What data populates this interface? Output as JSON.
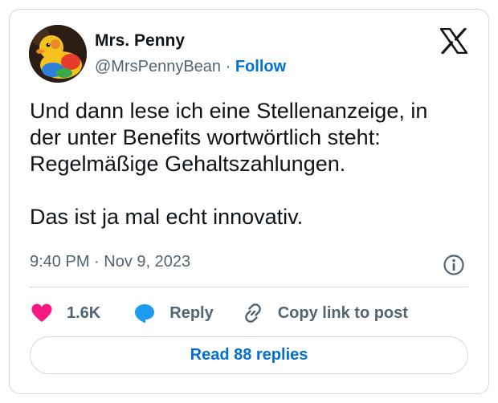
{
  "author": {
    "display_name": "Mrs. Penny",
    "handle": "@MrsPennyBean",
    "separator": " · ",
    "follow_label": "Follow",
    "avatar_icon": "rubber-duck-avatar"
  },
  "platform_icon": "x-logo-icon",
  "tweet": {
    "paragraphs": [
      "Und dann lese ich eine Stellenanzeige, in\nder unter Benefits wortwörtlich steht:\nRegelmäßige Gehaltszahlungen.",
      "Das ist ja mal echt innovativ."
    ],
    "timestamp": "9:40 PM · Nov 9, 2023"
  },
  "actions": {
    "like_count": "1.6K",
    "reply_label": "Reply",
    "copy_link_label": "Copy link to post"
  },
  "read_replies_label": "Read 88 replies",
  "colors": {
    "like_heart": "#f91880",
    "reply_bubble": "#1d9bf0",
    "link_blue": "#006fd6",
    "secondary_text": "#536471",
    "border": "#cfd9de"
  }
}
